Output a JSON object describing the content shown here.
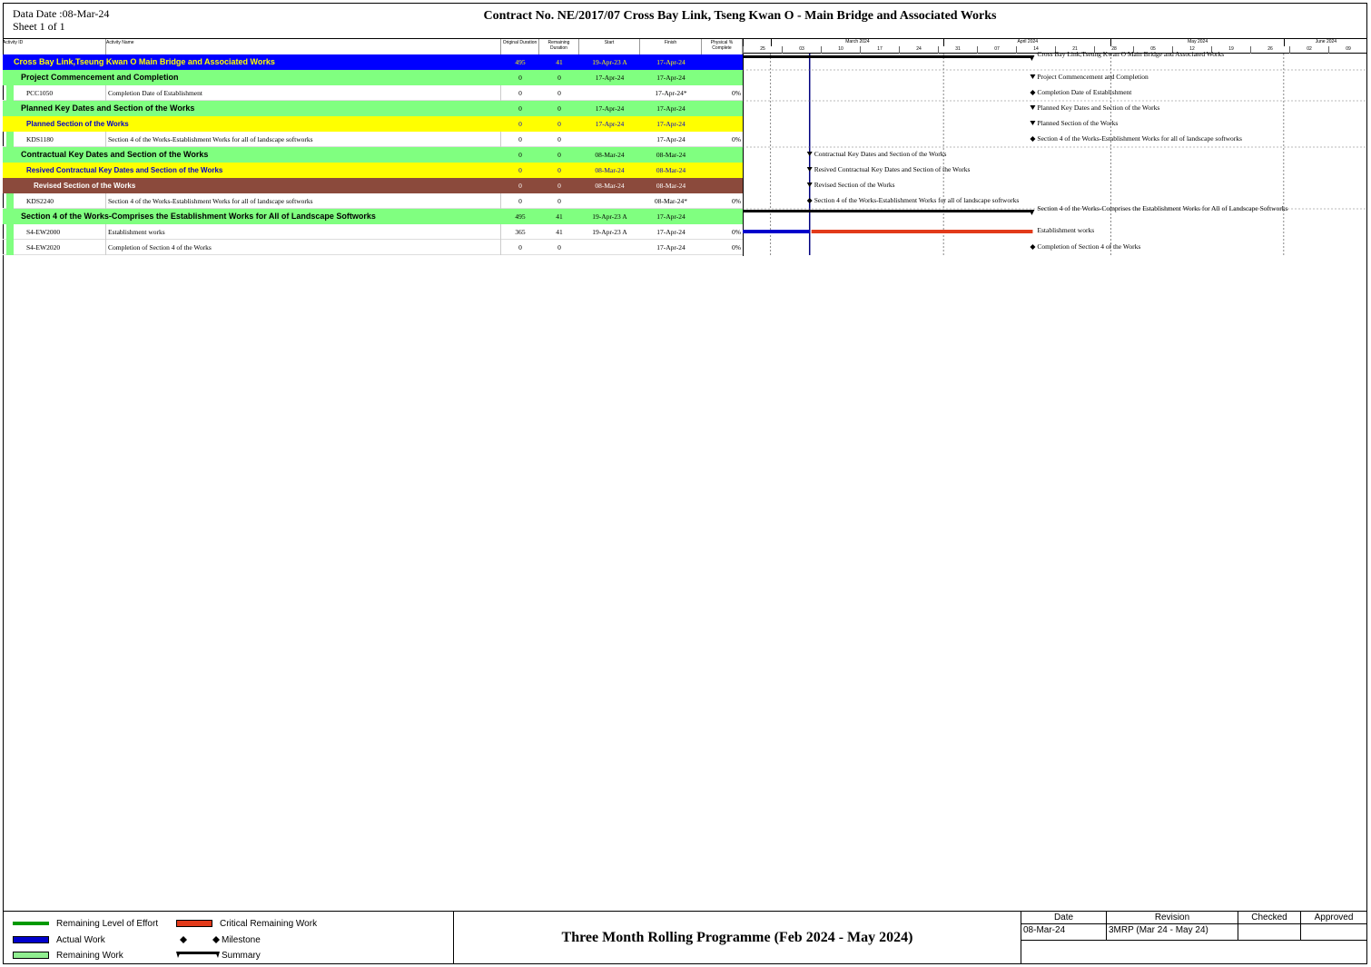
{
  "header": {
    "data_date": "Data Date :08-Mar-24",
    "sheet": "Sheet 1 of 1",
    "title": "Contract  No. NE/2017/07  Cross Bay Link, Tseng Kwan O - Main Bridge and Associated Works"
  },
  "columns": {
    "activity_id": "Activity ID",
    "activity_name": "Activity Name",
    "orig_dur": "Original Duration",
    "rem_dur": "Remaining Duration",
    "start": "Start",
    "finish": "Finish",
    "pct": "Physical % Complete"
  },
  "timeline": {
    "months": [
      {
        "label": "March 2024"
      },
      {
        "label": "April 2024"
      },
      {
        "label": "May 2024"
      },
      {
        "label": "June 2024"
      }
    ],
    "weeks": [
      "25",
      "03",
      "10",
      "17",
      "24",
      "31",
      "07",
      "14",
      "21",
      "28",
      "05",
      "12",
      "19",
      "26",
      "02",
      "09"
    ]
  },
  "chart_data": {
    "type": "gantt",
    "data_date": "08-Mar-24",
    "rows": [
      {
        "id": "",
        "name": "Cross Bay Link,Tseung Kwan O Main Bridge and Associated Works",
        "orig": "495",
        "rem": "41",
        "start": "19-Apr-23 A",
        "finish": "17-Apr-24",
        "pct": "",
        "level": 0,
        "bar_label": "Cross Bay Link,Tseung Kwan O Main Bridge and Associated Works"
      },
      {
        "id": "",
        "name": "Project Commencement and Completion",
        "orig": "0",
        "rem": "0",
        "start": "17-Apr-24",
        "finish": "17-Apr-24",
        "pct": "",
        "level": 1,
        "bar_label": "Project Commencement and Completion"
      },
      {
        "id": "PCC1050",
        "name": "Completion Date of Establishment",
        "orig": "0",
        "rem": "0",
        "start": "",
        "finish": "17-Apr-24*",
        "pct": "0%",
        "level": 9,
        "bar_label": "Completion Date of Establishment"
      },
      {
        "id": "",
        "name": "Planned Key Dates and Section of the Works",
        "orig": "0",
        "rem": "0",
        "start": "17-Apr-24",
        "finish": "17-Apr-24",
        "pct": "",
        "level": 1,
        "bar_label": "Planned Key Dates and Section of the Works"
      },
      {
        "id": "",
        "name": "Planned Section of the Works",
        "orig": "0",
        "rem": "0",
        "start": "17-Apr-24",
        "finish": "17-Apr-24",
        "pct": "",
        "level": 2,
        "bar_label": "Planned Section of the Works"
      },
      {
        "id": "KDS1180",
        "name": "Section 4 of the Works-Establishment Works for all of landscape softworks",
        "orig": "0",
        "rem": "0",
        "start": "",
        "finish": "17-Apr-24",
        "pct": "0%",
        "level": 9,
        "bar_label": "Section 4 of the Works-Establishment Works for all of landscape softworks"
      },
      {
        "id": "",
        "name": "Contractual Key Dates and Section of the Works",
        "orig": "0",
        "rem": "0",
        "start": "08-Mar-24",
        "finish": "08-Mar-24",
        "pct": "",
        "level": 1,
        "bar_label": "Contractual Key Dates and Section of the Works"
      },
      {
        "id": "",
        "name": "Resived Contractual Key Dates and Section of the Works",
        "orig": "0",
        "rem": "0",
        "start": "08-Mar-24",
        "finish": "08-Mar-24",
        "pct": "",
        "level": 2,
        "bar_label": "Resived Contractual Key Dates and Section of the Works"
      },
      {
        "id": "",
        "name": "Revised Section of the Works",
        "orig": "0",
        "rem": "0",
        "start": "08-Mar-24",
        "finish": "08-Mar-24",
        "pct": "",
        "level": 3,
        "bar_label": "Revised Section of the Works"
      },
      {
        "id": "KDS2240",
        "name": "Section 4 of the Works-Establishment Works for all of landscape softworks",
        "orig": "0",
        "rem": "0",
        "start": "",
        "finish": "08-Mar-24*",
        "pct": "0%",
        "level": 9,
        "bar_label": "Section 4 of the Works-Establishment Works for all of landscape softworks"
      },
      {
        "id": "",
        "name": "Section 4 of the Works-Comprises the Establishment Works for All of Landscape Softworks",
        "orig": "495",
        "rem": "41",
        "start": "19-Apr-23 A",
        "finish": "17-Apr-24",
        "pct": "",
        "level": 1,
        "bar_label": "Section 4 of the Works-Comprises the Establishment Works for All of Landscape Softworks"
      },
      {
        "id": "S4-EW2000",
        "name": "Establishment works",
        "orig": "365",
        "rem": "41",
        "start": "19-Apr-23 A",
        "finish": "17-Apr-24",
        "pct": "0%",
        "level": 9,
        "bar_label": "Establishment works"
      },
      {
        "id": "S4-EW2020",
        "name": "Completion of Section 4 of the Works",
        "orig": "0",
        "rem": "0",
        "start": "",
        "finish": "17-Apr-24",
        "pct": "0%",
        "level": 9,
        "bar_label": "Completion of Section 4 of the Works"
      }
    ]
  },
  "colors": {
    "level0": "#0000ff",
    "level1": "#80ff80",
    "level2": "#ffff00",
    "level3": "#8b4a3c",
    "actual": "#0000cc",
    "critical": "#e23a1a",
    "remaining": "#90ee90",
    "effort": "#009900"
  },
  "legend": {
    "remaining_effort": "Remaining Level of Effort",
    "actual_work": "Actual Work",
    "remaining_work": "Remaining Work",
    "critical_remaining": "Critical Remaining Work",
    "milestone": "Milestone",
    "summary": "Summary"
  },
  "footer": {
    "title": "Three Month Rolling Programme (Feb 2024 - May 2024)",
    "date_h": "Date",
    "revision_h": "Revision",
    "checked_h": "Checked",
    "approved_h": "Approved",
    "date": "08-Mar-24",
    "revision": "3MRP (Mar 24 - May 24)"
  }
}
